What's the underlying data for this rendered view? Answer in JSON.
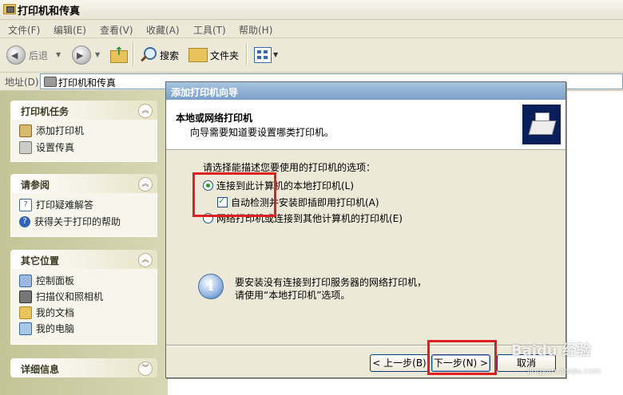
{
  "window": {
    "title": "打印机和传真"
  },
  "menu": [
    "文件(F)",
    "编辑(E)",
    "查看(V)",
    "收藏(A)",
    "工具(T)",
    "帮助(H)"
  ],
  "toolbar": {
    "back": "后退",
    "search": "搜索",
    "folders": "文件夹"
  },
  "address": {
    "label": "地址(D)",
    "value": "打印机和传真"
  },
  "left": {
    "printer_tasks": {
      "title": "打印机任务",
      "items": [
        "添加打印机",
        "设置传真"
      ]
    },
    "see_also": {
      "title": "请参阅",
      "items": [
        "打印疑难解答",
        "获得关于打印的帮助"
      ]
    },
    "other_places": {
      "title": "其它位置",
      "items": [
        "控制面板",
        "扫描仪和照相机",
        "我的文档",
        "我的电脑"
      ]
    },
    "details": {
      "title": "详细信息"
    }
  },
  "wizard": {
    "title": "添加打印机向导",
    "heading": "本地或网络打印机",
    "subheading": "向导需要知道要设置哪类打印机。",
    "prompt": "请选择能描述您要使用的打印机的选项：",
    "option_local": "连接到此计算机的本地打印机(L)",
    "option_autodetect": "自动检测并安装即插即用打印机(A)",
    "option_network": "网络打印机或连接到其他计算机的打印机(E)",
    "info_line1": "要安装没有连接到打印服务器的网络打印机，",
    "info_line2": "请使用“本地打印机”选项。",
    "btn_back": "< 上一步(B)",
    "btn_next": "下一步(N) >",
    "btn_cancel": "取消",
    "selected": "local",
    "autodetect_checked": true
  },
  "watermark": {
    "line1": "Baidu 经验",
    "line2": "jingyan.baidu.com"
  },
  "colors": {
    "highlight": "#e02020"
  }
}
